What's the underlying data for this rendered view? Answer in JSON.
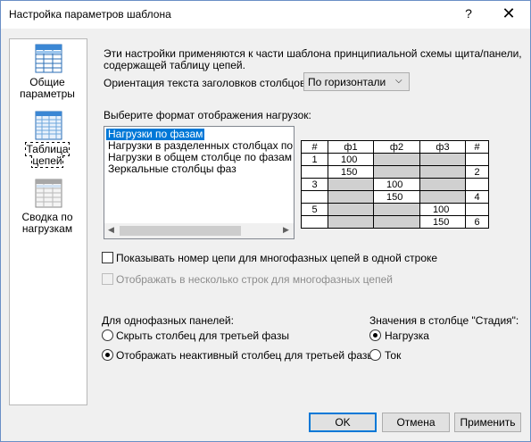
{
  "window": {
    "title": "Настройка параметров шаблона",
    "help": "?",
    "close": "✕"
  },
  "nav": {
    "items": [
      {
        "label": "Общие параметры",
        "icon": "general-settings-icon"
      },
      {
        "label": "Таблица цепей",
        "icon": "circuit-table-icon"
      },
      {
        "label": "Сводка по нагрузкам",
        "icon": "load-summary-icon"
      }
    ]
  },
  "content": {
    "description_line1": "Эти настройки применяются к части шаблона принципиальной схемы щита/панели,",
    "description_line2": "содержащей таблицу цепей.",
    "orientation_label": "Ориентация текста заголовков столбцов:",
    "orientation_value": "По горизонтали",
    "format_label": "Выберите формат отображения нагрузок:",
    "format_options": [
      "Нагрузки по фазам",
      "Нагрузки в разделенных столбцах по фазам",
      "Нагрузки в общем столбце по фазам",
      "Зеркальные столбцы фаз"
    ],
    "preview": {
      "headers": [
        "#",
        "ф1",
        "ф2",
        "ф3",
        "#"
      ],
      "rows": [
        [
          "1",
          "100",
          "",
          "",
          ""
        ],
        [
          "",
          "150",
          "",
          "",
          "2"
        ],
        [
          "3",
          "",
          "100",
          "",
          ""
        ],
        [
          "",
          "",
          "150",
          "",
          "4"
        ],
        [
          "5",
          "",
          "",
          "100",
          ""
        ],
        [
          "",
          "",
          "",
          "150",
          "6"
        ]
      ]
    },
    "show_circuit_number": "Показывать номер цепи для многофазных цепей в одной строке",
    "multi_row": "Отображать в несколько строк для многофазных цепей",
    "single_phase_label": "Для однофазных панелей:",
    "hide_third_phase": "Скрыть столбец для третьей фазы",
    "show_inactive_third_phase": "Отображать неактивный столбец для третьей фазы",
    "stage_label": "Значения в столбце \"Стадия\":",
    "stage_load": "Нагрузка",
    "stage_current": "Ток"
  },
  "buttons": {
    "ok": "OK",
    "cancel": "Отмена",
    "apply": "Применить"
  }
}
